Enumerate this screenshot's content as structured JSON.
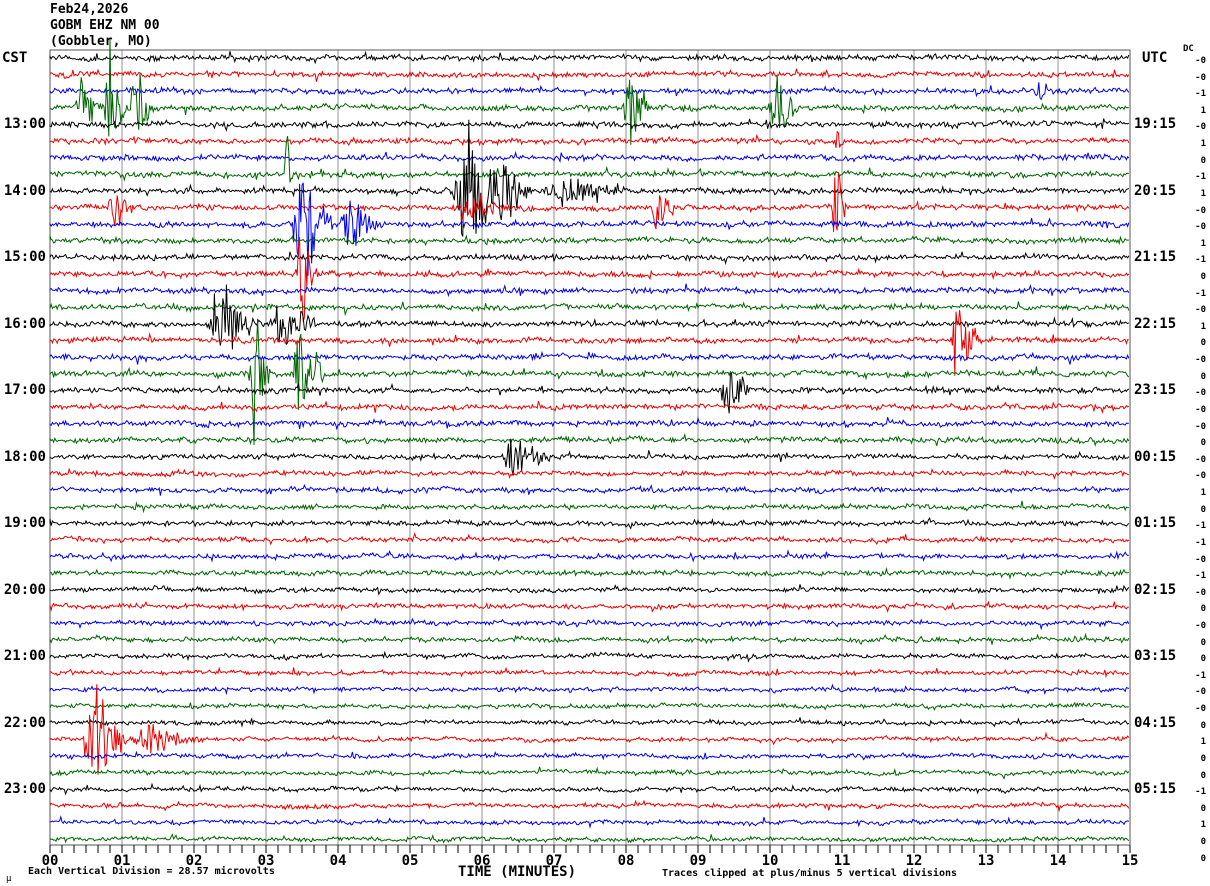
{
  "header": {
    "date": "Feb24,2026",
    "station": "GOBM EHZ NM 00",
    "location": "(Gobbler, MO)",
    "left_tz": "CST",
    "right_tz": "UTC",
    "dc_label": "DC"
  },
  "left_times": [
    "13:00",
    "14:00",
    "15:00",
    "16:00",
    "17:00",
    "18:00",
    "19:00",
    "20:00",
    "21:00",
    "22:00",
    "23:00"
  ],
  "right_times": [
    "19:15",
    "20:15",
    "21:15",
    "22:15",
    "23:15",
    "00:15",
    "01:15",
    "02:15",
    "03:15",
    "04:15",
    "05:15"
  ],
  "dc_values": [
    "-0",
    "-0",
    "-1",
    "1",
    "-0",
    "1",
    "0",
    "-1",
    "1",
    "-0",
    "-0",
    "1",
    "-1",
    "0",
    "-1",
    "-0",
    "1",
    "0",
    "-0",
    "0",
    "-0",
    "-0",
    "-0",
    "0",
    "-0",
    "-0",
    "1",
    "0",
    "-1",
    "-1",
    "-0",
    "-1",
    "-0",
    "0",
    "-0",
    "0",
    "0",
    "-1",
    "-0",
    "-0",
    "0",
    "1",
    "0",
    "0",
    "-1",
    "0",
    "1",
    "0",
    "0"
  ],
  "x_axis": {
    "labels": [
      "00",
      "01",
      "02",
      "03",
      "04",
      "05",
      "06",
      "07",
      "08",
      "09",
      "10",
      "11",
      "12",
      "13",
      "14",
      "15"
    ],
    "title": "TIME (MINUTES)"
  },
  "footer": {
    "left": "Each Vertical Division =   28.57 microvolts",
    "right": "Traces clipped at plus/minus 5 vertical divisions",
    "micro": "µ"
  },
  "colors": {
    "trace_cycle": [
      "#000000",
      "#ee0000",
      "#0000ee",
      "#006600"
    ],
    "grid": "#909090",
    "frame": "#555555",
    "bg": "#ffffff"
  },
  "chart_data": {
    "type": "line",
    "subtype": "helicorder-seismogram",
    "title": "GOBM EHZ NM 00 (Gobbler, MO) Feb24,2026",
    "xlabel": "TIME (MINUTES)",
    "x_range_minutes": [
      0,
      15
    ],
    "rows": 48,
    "minutes_per_row": 15,
    "first_row_time_cst": "12:00",
    "hour_label_rows": [
      4,
      8,
      12,
      16,
      20,
      24,
      28,
      32,
      36,
      40,
      44
    ],
    "row_color_cycle": [
      "black",
      "red",
      "blue",
      "green"
    ],
    "clip_divisions": 5,
    "microvolts_per_division": 28.57,
    "grid": true,
    "events": [
      {
        "row": 2,
        "start_min": 13.65,
        "end_min": 14.05,
        "amp_div": 1.2
      },
      {
        "row": 3,
        "start_min": 0.35,
        "end_min": 0.75,
        "amp_div": 3.0
      },
      {
        "row": 3,
        "start_min": 0.75,
        "end_min": 1.1,
        "amp_div": 5.0
      },
      {
        "row": 3,
        "start_min": 1.1,
        "end_min": 1.45,
        "amp_div": 5.0
      },
      {
        "row": 3,
        "start_min": 7.95,
        "end_min": 8.45,
        "amp_div": 2.8
      },
      {
        "row": 3,
        "start_min": 9.95,
        "end_min": 10.45,
        "amp_div": 2.8
      },
      {
        "row": 5,
        "start_min": 10.9,
        "end_min": 11.05,
        "amp_div": 1.5
      },
      {
        "row": 7,
        "start_min": 3.25,
        "end_min": 3.4,
        "amp_div": 5.0
      },
      {
        "row": 8,
        "start_min": 5.55,
        "end_min": 6.8,
        "amp_div": 5.0
      },
      {
        "row": 8,
        "start_min": 6.8,
        "end_min": 8.3,
        "amp_div": 1.3
      },
      {
        "row": 9,
        "start_min": 0.8,
        "end_min": 1.15,
        "amp_div": 2.2
      },
      {
        "row": 9,
        "start_min": 5.6,
        "end_min": 6.6,
        "amp_div": 1.2
      },
      {
        "row": 9,
        "start_min": 8.35,
        "end_min": 8.75,
        "amp_div": 2.0
      },
      {
        "row": 9,
        "start_min": 10.85,
        "end_min": 11.1,
        "amp_div": 3.5
      },
      {
        "row": 10,
        "start_min": 3.35,
        "end_min": 4.0,
        "amp_div": 5.0
      },
      {
        "row": 10,
        "start_min": 4.0,
        "end_min": 4.7,
        "amp_div": 2.0
      },
      {
        "row": 13,
        "start_min": 3.4,
        "end_min": 3.75,
        "amp_div": 4.0
      },
      {
        "row": 16,
        "start_min": 2.15,
        "end_min": 3.0,
        "amp_div": 3.2
      },
      {
        "row": 16,
        "start_min": 3.0,
        "end_min": 3.85,
        "amp_div": 2.0
      },
      {
        "row": 17,
        "start_min": 12.5,
        "end_min": 12.95,
        "amp_div": 4.5
      },
      {
        "row": 19,
        "start_min": 2.75,
        "end_min": 3.1,
        "amp_div": 5.0
      },
      {
        "row": 19,
        "start_min": 3.35,
        "end_min": 3.85,
        "amp_div": 5.0
      },
      {
        "row": 20,
        "start_min": 9.3,
        "end_min": 9.75,
        "amp_div": 3.8
      },
      {
        "row": 24,
        "start_min": 6.25,
        "end_min": 7.1,
        "amp_div": 1.8
      },
      {
        "row": 41,
        "start_min": 0.45,
        "end_min": 1.1,
        "amp_div": 5.0
      },
      {
        "row": 41,
        "start_min": 1.1,
        "end_min": 2.2,
        "amp_div": 1.4
      }
    ]
  }
}
